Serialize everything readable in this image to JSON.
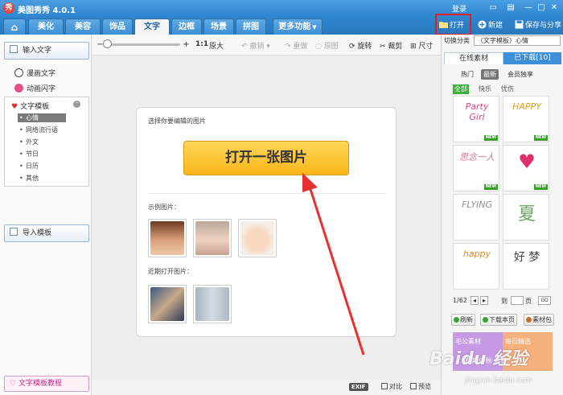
{
  "window": {
    "logo_char": "秀",
    "title": "美图秀秀 4.0.1",
    "login": "登录",
    "buttons": {
      "minimize": "—",
      "maximize": "□",
      "close": "✕"
    }
  },
  "tabs": [
    {
      "label": "⌂",
      "icon": "home-icon"
    },
    {
      "label": "美化"
    },
    {
      "label": "美容"
    },
    {
      "label": "饰品"
    },
    {
      "label": "文字"
    },
    {
      "label": "边框"
    },
    {
      "label": "场景"
    },
    {
      "label": "拼图"
    },
    {
      "label": "更多功能"
    }
  ],
  "topbar": {
    "open": "打开",
    "new": "新建",
    "save_share": "保存与分享"
  },
  "left": {
    "input_text": "输入文字",
    "comic_text": "漫画文字",
    "animated_text": "动画闪字",
    "template_header": "文字模板",
    "template_items": [
      "心情",
      "网络流行语",
      "外文",
      "节日",
      "日历",
      "其他"
    ],
    "import_template": "导入模板",
    "tutorial": "文字模板教程"
  },
  "toolbar": {
    "zoom_out": "−",
    "zoom_in": "+",
    "ratio": "1:1",
    "original": "原大",
    "undo": "撤销",
    "redo": "重做",
    "restore": "原图",
    "rotate": "旋转",
    "crop": "裁剪",
    "resize": "尺寸"
  },
  "canvas": {
    "prompt": "选择你要编辑的图片",
    "open_button": "打开一张图片",
    "samples_label": "示例图片：",
    "recent_label": "近期打开图片："
  },
  "status": {
    "exif": "EXIF",
    "compare": "对比",
    "preview": "预览"
  },
  "right": {
    "category_label": "切换分类",
    "category_value": "〈文字模板〉心情",
    "tab_online": "在线素材",
    "tab_downloaded": "已下载[10]",
    "filters": [
      "热门",
      "最新",
      "会员独享"
    ],
    "subfilters": [
      "全部",
      "快乐",
      "忧伤"
    ],
    "items": [
      {
        "art": "Party Girl",
        "badge": "NEW",
        "color": "#d04a8a"
      },
      {
        "art": "HAPPY",
        "badge": "NEW",
        "color": "#d9a020"
      },
      {
        "art": "思念一人",
        "badge": "NEW",
        "color": "#e07090"
      },
      {
        "art": "♥",
        "badge": "NEW",
        "color": "#e0306a"
      },
      {
        "art": "FLYING",
        "badge": "",
        "color": "#909090"
      },
      {
        "art": "夏",
        "badge": "",
        "color": "#6aa860"
      },
      {
        "art": "happy",
        "badge": "",
        "color": "#e08a20"
      },
      {
        "art": "好 梦",
        "badge": "",
        "color": "#444444"
      }
    ],
    "pager": {
      "current": "1/62",
      "goto": "到",
      "page": "页",
      "go": "GO"
    },
    "actions": {
      "refresh": "刷新",
      "download_page": "下载本页",
      "material_pack": "素材包"
    },
    "banner": {
      "left": "毛公素材",
      "right": "每日精选",
      "bottom": "唯美·中秋·素材"
    }
  },
  "watermark": {
    "main": "Baidu 经验",
    "sub": "jingyan.baidu.com"
  },
  "colors": {
    "accent": "#2f86cf",
    "highlight": "#e02020",
    "open_button": "#f8b619"
  }
}
